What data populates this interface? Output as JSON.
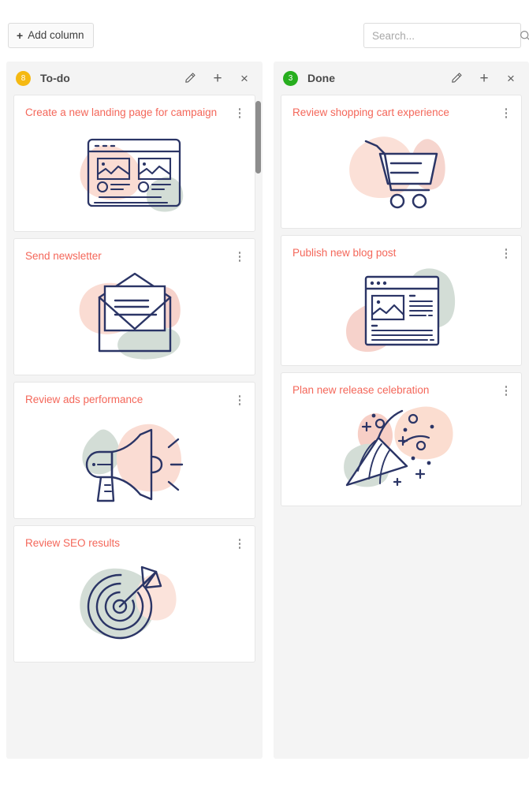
{
  "toolbar": {
    "add_column_label": "Add column",
    "add_column_plus": "+",
    "search_placeholder": "Search...",
    "search_value": "",
    "search_icon_name": "search-icon"
  },
  "colors": {
    "card_title": "#f4675a",
    "badge_todo": "#f5b912",
    "badge_done": "#27ae1e",
    "illustration_line": "#2b3566",
    "blob_pink": "#fadcd3",
    "blob_green": "#d3ddd6",
    "board_bg": "#ffffff",
    "column_bg": "#f4f4f4",
    "card_bg": "#ffffff"
  },
  "columns": [
    {
      "id": "todo",
      "title": "To-do",
      "count": "8",
      "badge_color": "amber",
      "actions": {
        "edit": "edit-icon",
        "add": "+",
        "close": "×"
      },
      "has_scrollbar": true,
      "cards": [
        {
          "title": "Create a new landing page for campaign",
          "illustration": "landing-page-illustration"
        },
        {
          "title": "Send newsletter",
          "illustration": "envelope-illustration"
        },
        {
          "title": "Review ads performance",
          "illustration": "megaphone-illustration"
        },
        {
          "title": "Review SEO results",
          "illustration": "target-illustration"
        }
      ]
    },
    {
      "id": "done",
      "title": "Done",
      "count": "3",
      "badge_color": "green",
      "actions": {
        "edit": "edit-icon",
        "add": "+",
        "close": "×"
      },
      "has_scrollbar": false,
      "cards": [
        {
          "title": "Review shopping cart experience",
          "illustration": "shopping-cart-illustration"
        },
        {
          "title": "Publish new blog post",
          "illustration": "blog-post-illustration"
        },
        {
          "title": "Plan new release celebration",
          "illustration": "party-popper-illustration"
        }
      ]
    }
  ]
}
